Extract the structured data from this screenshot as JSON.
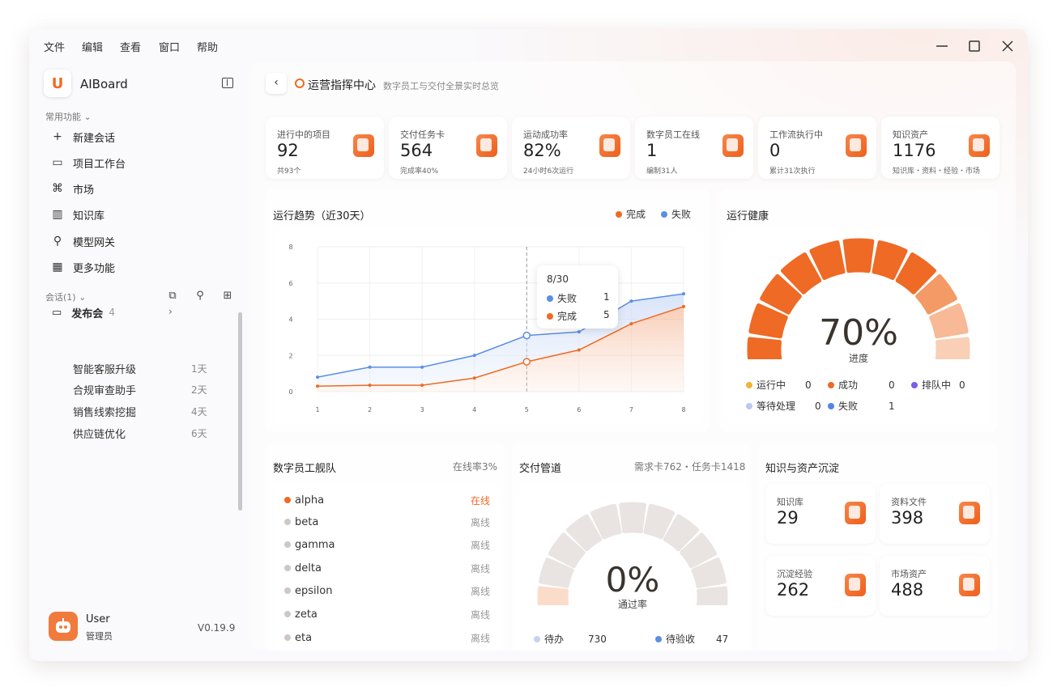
{
  "menu": [
    "文件",
    "编辑",
    "查看",
    "窗口",
    "帮助"
  ],
  "brand": {
    "logo": "U",
    "name": "AIBoard"
  },
  "sidebar": {
    "section_common": "常用功能",
    "items": [
      {
        "label": "新建会话",
        "icon": "+"
      },
      {
        "label": "项目工作台",
        "icon": "▭"
      },
      {
        "label": "市场",
        "icon": "⌘"
      },
      {
        "label": "知识库",
        "icon": "▥"
      },
      {
        "label": "模型网关",
        "icon": "⚲"
      },
      {
        "label": "更多功能",
        "icon": "▦"
      }
    ],
    "section_sessions": "会话(1)",
    "group": {
      "name": "发布会",
      "count": "4"
    },
    "sessions": [
      {
        "name": "智能客服升级",
        "time": "1天"
      },
      {
        "name": "合规审查助手",
        "time": "2天"
      },
      {
        "name": "销售线索挖掘",
        "time": "4天"
      },
      {
        "name": "供应链优化",
        "time": "6天"
      }
    ]
  },
  "user": {
    "name": "User",
    "role": "管理员",
    "version": "V0.19.9"
  },
  "header": {
    "title": "运营指挥中心",
    "subtitle": "数字员工与交付全景实时总览"
  },
  "kpis": [
    {
      "label": "进行中的项目",
      "value": "92",
      "note": "共93个"
    },
    {
      "label": "交付任务卡",
      "value": "564",
      "note": "完成率40%"
    },
    {
      "label": "运动成功率",
      "value": "82%",
      "note": "24小时6次运行"
    },
    {
      "label": "数字员工在线",
      "value": "1",
      "note": "编制31人"
    },
    {
      "label": "工作流执行中",
      "value": "0",
      "note": "累计31次执行"
    },
    {
      "label": "知识资产",
      "value": "1176",
      "note": "知识库・资料・经验・市场"
    }
  ],
  "trend": {
    "title": "运行趋势（近30天）",
    "legend_done": "完成",
    "legend_fail": "失败",
    "tooltip": {
      "date": "8/30",
      "fail_label": "失败",
      "fail_value": "1",
      "done_label": "完成",
      "done_value": "5"
    }
  },
  "chart_data": {
    "type": "area",
    "x": [
      1,
      2,
      3,
      4,
      5,
      6,
      7,
      8
    ],
    "x_ticks": [
      "1",
      "2",
      "3",
      "4",
      "5",
      "6",
      "7",
      "8"
    ],
    "y_ticks": [
      "0",
      "2",
      "4",
      "6",
      "8"
    ],
    "ylim": [
      0,
      8
    ],
    "series": [
      {
        "name": "失败",
        "color": "#5b8ee6",
        "values": [
          0.8,
          1.35,
          1.35,
          2.0,
          3.1,
          3.3,
          5.0,
          5.4
        ]
      },
      {
        "name": "完成",
        "color": "#ee6a25",
        "values": [
          0.3,
          0.35,
          0.35,
          0.75,
          1.65,
          2.3,
          3.75,
          4.7
        ]
      }
    ],
    "highlight_x": 5
  },
  "health": {
    "title": "运行健康",
    "percent": "70%",
    "caption": "进度",
    "progress": 0.7,
    "legend": [
      {
        "label": "运行中",
        "value": "0",
        "color": "#f1b338"
      },
      {
        "label": "成功",
        "value": "0",
        "color": "#ee6a25"
      },
      {
        "label": "排队中",
        "value": "0",
        "color": "#7c5ce8"
      },
      {
        "label": "等待处理",
        "value": "0",
        "color": "#b9c8ee"
      },
      {
        "label": "失败",
        "value": "1",
        "color": "#4f86e6"
      }
    ]
  },
  "fleet": {
    "title": "数字员工舰队",
    "rate": "在线率3%",
    "members": [
      {
        "name": "alpha",
        "state": "在线",
        "online": true
      },
      {
        "name": "beta",
        "state": "离线",
        "online": false
      },
      {
        "name": "gamma",
        "state": "离线",
        "online": false
      },
      {
        "name": "delta",
        "state": "离线",
        "online": false
      },
      {
        "name": "epsilon",
        "state": "离线",
        "online": false
      },
      {
        "name": "zeta",
        "state": "离线",
        "online": false
      },
      {
        "name": "eta",
        "state": "离线",
        "online": false
      }
    ]
  },
  "pipeline": {
    "title": "交付管道",
    "summary": "需求卡762・任务卡1418",
    "percent": "0%",
    "caption": "通过率",
    "progress": 0.0,
    "legend": [
      {
        "label": "待办",
        "value": "730",
        "color": "#c5d3f2"
      },
      {
        "label": "待验收",
        "value": "47",
        "color": "#5b8ee6"
      }
    ]
  },
  "knowledge": {
    "title": "知识与资产沉淀",
    "items": [
      {
        "label": "知识库",
        "value": "29"
      },
      {
        "label": "资料文件",
        "value": "398"
      },
      {
        "label": "沉淀经验",
        "value": "262"
      },
      {
        "label": "市场资产",
        "value": "488"
      }
    ]
  }
}
